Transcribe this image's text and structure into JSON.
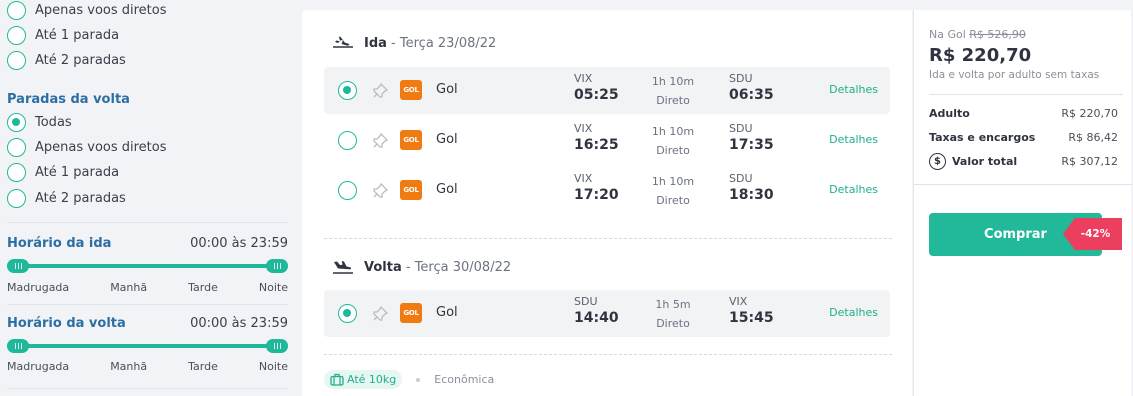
{
  "filters": {
    "outbound_stops_options": [
      {
        "label": "Apenas voos diretos",
        "checked": false
      },
      {
        "label": "Até 1 parada",
        "checked": false
      },
      {
        "label": "Até 2 paradas",
        "checked": false
      }
    ],
    "return_stops": {
      "title": "Paradas da volta",
      "options": [
        {
          "label": "Todas",
          "checked": true
        },
        {
          "label": "Apenas voos diretos",
          "checked": false
        },
        {
          "label": "Até 1 parada",
          "checked": false
        },
        {
          "label": "Até 2 paradas",
          "checked": false
        }
      ]
    },
    "outbound_time": {
      "title": "Horário da ida",
      "value": "00:00 às 23:59",
      "range": [
        0,
        1
      ]
    },
    "return_time": {
      "title": "Horário da volta",
      "value": "00:00 às 23:59",
      "range": [
        0,
        1
      ]
    },
    "periods": [
      "Madrugada",
      "Manhã",
      "Tarde",
      "Noite"
    ]
  },
  "outbound": {
    "name": "Ida",
    "date": " - Terça 23/08/22",
    "flights": [
      {
        "airline": "Gol",
        "logo": "GOL",
        "from": "VIX",
        "dep": "05:25",
        "duration": "1h 10m",
        "type": "Direto",
        "to": "SDU",
        "arr": "06:35",
        "details": "Detalhes",
        "selected": true
      },
      {
        "airline": "Gol",
        "logo": "GOL",
        "from": "VIX",
        "dep": "16:25",
        "duration": "1h 10m",
        "type": "Direto",
        "to": "SDU",
        "arr": "17:35",
        "details": "Detalhes",
        "selected": false
      },
      {
        "airline": "Gol",
        "logo": "GOL",
        "from": "VIX",
        "dep": "17:20",
        "duration": "1h 10m",
        "type": "Direto",
        "to": "SDU",
        "arr": "18:30",
        "details": "Detalhes",
        "selected": false
      }
    ]
  },
  "return": {
    "name": "Volta",
    "date": " - Terça 30/08/22",
    "flights": [
      {
        "airline": "Gol",
        "logo": "GOL",
        "from": "SDU",
        "dep": "14:40",
        "duration": "1h 5m",
        "type": "Direto",
        "to": "VIX",
        "arr": "15:45",
        "details": "Detalhes",
        "selected": true
      }
    ]
  },
  "baggage": {
    "label": "Até 10kg",
    "cabin_class": "Econômica"
  },
  "summary": {
    "original_prefix": "Na Gol",
    "original_price": "R$ 526,90",
    "price": "R$ 220,70",
    "price_note": "Ida e volta por adulto sem taxas",
    "rows": [
      {
        "label": "Adulto",
        "value": "R$ 220,70"
      },
      {
        "label": "Taxas e encargos",
        "value": "R$ 86,42"
      },
      {
        "label": "Valor total",
        "value": "R$ 307,12"
      }
    ],
    "buy_label": "Comprar",
    "discount": "-42%"
  },
  "colors": {
    "accent": "#22b89a",
    "heading": "#2d6fa3",
    "discount": "#ec3e5f",
    "airline_logo": "#ef7b12"
  },
  "icons": [
    "radio-icon",
    "departure-plane-icon",
    "return-plane-icon",
    "pin-icon",
    "luggage-icon",
    "dollar-icon",
    "slider-handle-icon"
  ]
}
